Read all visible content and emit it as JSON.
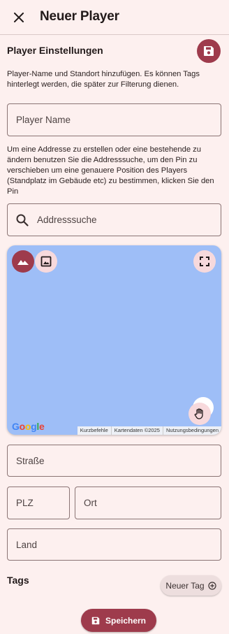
{
  "appbar": {
    "title": "Neuer Player",
    "close_icon": "close-icon"
  },
  "settings": {
    "title": "Player Einstellungen",
    "save_icon": "floppy-disk-icon",
    "description": "Player-Name und Standort hinzufügen. Es können Tags hinterlegt werden, die später zur Filterung dienen."
  },
  "form": {
    "player_name": {
      "placeholder": "Player Name",
      "value": ""
    },
    "address_help": "Um eine Addresse zu erstellen oder eine bestehende zu ändern benutzen Sie die Addresssuche, um den Pin zu verschieben um eine genauere Position des Players (Standplatz im Gebäude etc) zu bestimmen, klicken Sie den Pin",
    "address_search": {
      "placeholder": "Addresssuche",
      "value": "",
      "icon": "search-icon"
    },
    "street": {
      "placeholder": "Straße",
      "value": ""
    },
    "plz": {
      "placeholder": "PLZ",
      "value": ""
    },
    "ort": {
      "placeholder": "Ort",
      "value": ""
    },
    "land": {
      "placeholder": "Land",
      "value": ""
    }
  },
  "map": {
    "controls": [
      "terrain-icon",
      "image-icon",
      "fullscreen-icon",
      "hand-icon"
    ],
    "logo": "Google",
    "attribution": [
      "Kurzbefehle",
      "Kartendaten ©2025",
      "Nutzungsbedingungen"
    ],
    "background": "#9ebef7"
  },
  "tags": {
    "title": "Tags",
    "new_tag_label": "Neuer Tag",
    "new_tag_icon": "add-circle-icon"
  },
  "footer": {
    "save_label": "Speichern",
    "save_icon": "floppy-disk-icon"
  },
  "colors": {
    "primary": "#9e3b4c",
    "background": "#fdf0ef",
    "tonal": "#f7d9dc"
  }
}
